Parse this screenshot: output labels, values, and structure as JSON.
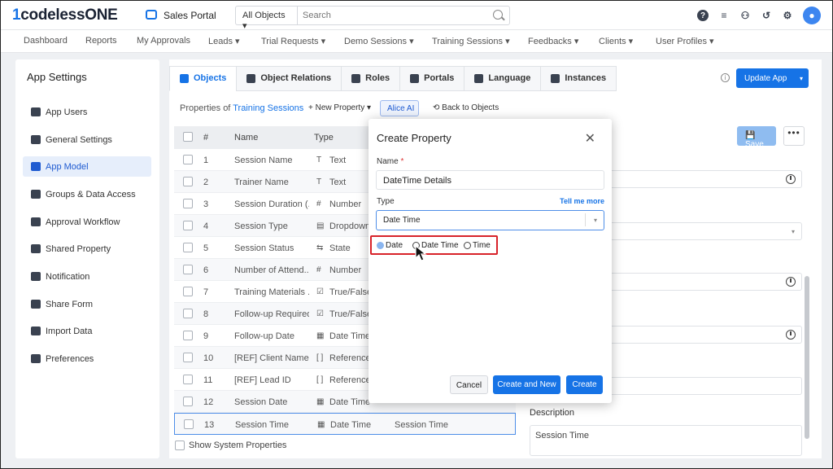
{
  "brand": {
    "logo_prefix": "1",
    "logo_text": "codeless",
    "logo_suffix": "ONE",
    "app_name": "Sales Portal"
  },
  "search": {
    "scope": "All Objects",
    "placeholder": "Search"
  },
  "nav": [
    "Dashboard",
    "Reports",
    "My Approvals",
    "Leads",
    "Trial Requests",
    "Demo Sessions",
    "Training Sessions",
    "Feedbacks",
    "Clients",
    "User Profiles"
  ],
  "sidebar": {
    "title": "App Settings",
    "items": [
      {
        "label": "App Users",
        "icon": "users-icon"
      },
      {
        "label": "General Settings",
        "icon": "gear-icon"
      },
      {
        "label": "App Model",
        "icon": "cube-icon"
      },
      {
        "label": "Groups & Data Access",
        "icon": "group-icon"
      },
      {
        "label": "Approval Workflow",
        "icon": "workflow-icon"
      },
      {
        "label": "Shared Property",
        "icon": "shared-icon"
      },
      {
        "label": "Notification",
        "icon": "bell-icon"
      },
      {
        "label": "Share Form",
        "icon": "form-icon"
      },
      {
        "label": "Import Data",
        "icon": "cloud-upload-icon"
      },
      {
        "label": "Preferences",
        "icon": "preferences-icon"
      }
    ]
  },
  "tabs": [
    "Objects",
    "Object Relations",
    "Roles",
    "Portals",
    "Language",
    "Instances"
  ],
  "toolbar": {
    "update_label": "Update App",
    "props_of": "Properties of",
    "object_name": "Training Sessions",
    "new_property": "+ New Property",
    "alice": "Alice AI",
    "back": "Back to Objects",
    "save": "Save"
  },
  "table": {
    "headers": [
      "#",
      "Name",
      "Type"
    ],
    "rows": [
      {
        "num": "1",
        "name": "Session Name",
        "type_icon": "T",
        "type": "Text",
        "extra": ""
      },
      {
        "num": "2",
        "name": "Trainer Name",
        "type_icon": "T",
        "type": "Text",
        "extra": ""
      },
      {
        "num": "3",
        "name": "Session Duration (...",
        "type_icon": "#",
        "type": "Number",
        "extra": ""
      },
      {
        "num": "4",
        "name": "Session Type",
        "type_icon": "▤",
        "type": "Dropdown",
        "extra": ""
      },
      {
        "num": "5",
        "name": "Session Status",
        "type_icon": "⇆",
        "type": "State",
        "extra": ""
      },
      {
        "num": "6",
        "name": "Number of Attend...",
        "type_icon": "#",
        "type": "Number",
        "extra": ""
      },
      {
        "num": "7",
        "name": "Training Materials ...",
        "type_icon": "☑",
        "type": "True/False",
        "extra": ""
      },
      {
        "num": "8",
        "name": "Follow-up Required",
        "type_icon": "☑",
        "type": "True/False",
        "extra": ""
      },
      {
        "num": "9",
        "name": "Follow-up Date",
        "type_icon": "▦",
        "type": "Date Time",
        "extra": ""
      },
      {
        "num": "10",
        "name": "[REF] Client Name",
        "type_icon": "[ ]",
        "type": "Referenced",
        "extra": ""
      },
      {
        "num": "11",
        "name": "[REF] Lead ID",
        "type_icon": "[ ]",
        "type": "Referenced",
        "extra": ""
      },
      {
        "num": "12",
        "name": "Session Date",
        "type_icon": "▦",
        "type": "Date Time",
        "extra": ""
      },
      {
        "num": "13",
        "name": "Session Time",
        "type_icon": "▦",
        "type": "Date Time",
        "extra": "Session Time"
      }
    ],
    "show_system": "Show System Properties"
  },
  "detail": {
    "description_label": "Description",
    "description_value": "Session Time"
  },
  "dialog": {
    "title": "Create Property",
    "name_label": "Name",
    "required_mark": "*",
    "name_value": "DateTime Details",
    "type_label": "Type",
    "tell_more": "Tell me more",
    "type_value": "Date Time",
    "radios": [
      {
        "label": "Date",
        "selected": true
      },
      {
        "label": "Date Time",
        "selected": false
      },
      {
        "label": "Time",
        "selected": false
      }
    ],
    "cancel": "Cancel",
    "create_new": "Create and New",
    "create": "Create"
  },
  "colors": {
    "accent": "#1673e6",
    "highlight_box": "#d8232a",
    "active_bg": "#e6eefb"
  }
}
